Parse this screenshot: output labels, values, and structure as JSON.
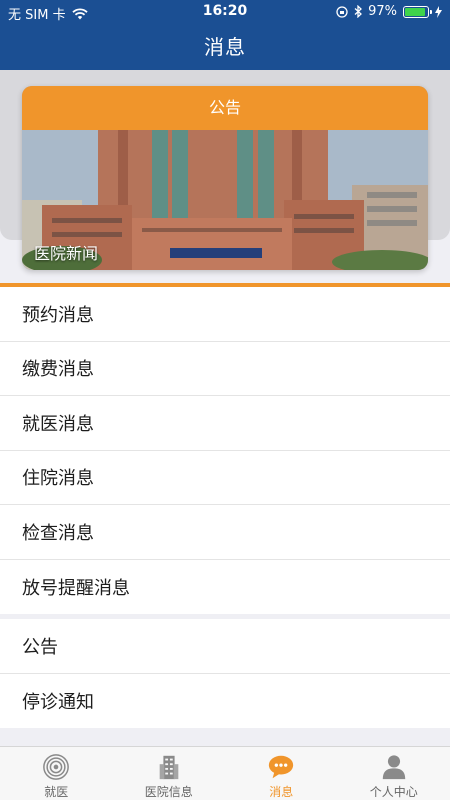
{
  "status_bar": {
    "carrier": "无 SIM 卡",
    "time": "16:20",
    "battery": "97%"
  },
  "nav": {
    "title": "消息"
  },
  "banner": {
    "header": "公告",
    "caption": "医院新闻"
  },
  "messages": [
    {
      "label": "预约消息"
    },
    {
      "label": "缴费消息"
    },
    {
      "label": "就医消息"
    },
    {
      "label": "住院消息"
    },
    {
      "label": "检查消息"
    },
    {
      "label": "放号提醒消息"
    }
  ],
  "notices": [
    {
      "label": "公告"
    },
    {
      "label": "停诊通知"
    }
  ],
  "tabs": [
    {
      "label": "就医",
      "icon": "target-icon",
      "active": false
    },
    {
      "label": "医院信息",
      "icon": "building-icon",
      "active": false
    },
    {
      "label": "消息",
      "icon": "chat-bubble-icon",
      "active": true
    },
    {
      "label": "个人中心",
      "icon": "person-icon",
      "active": false
    }
  ],
  "colors": {
    "nav_bg": "#1b4f93",
    "accent": "#f0952b"
  }
}
